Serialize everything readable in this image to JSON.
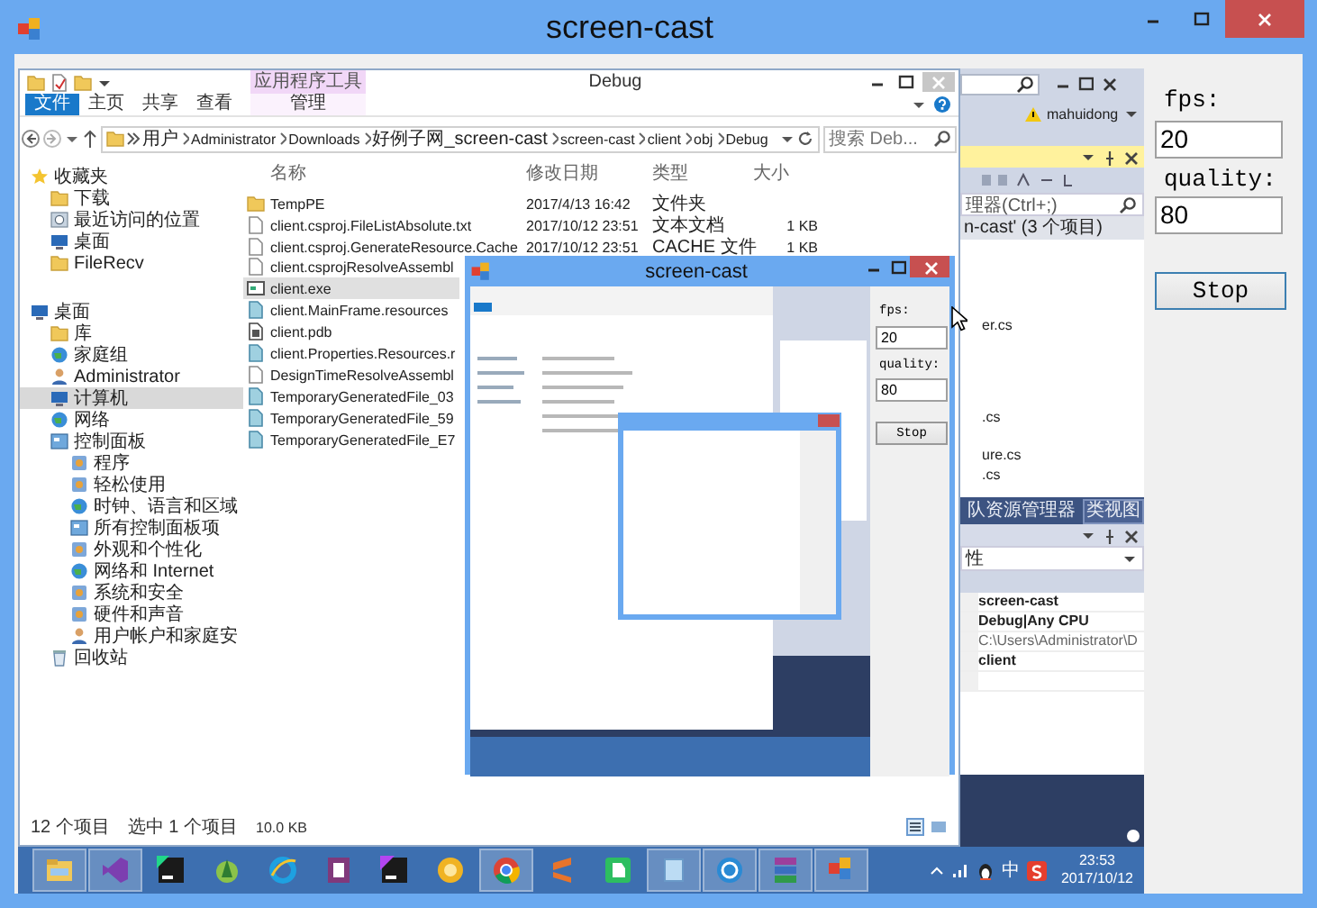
{
  "window": {
    "title": "screen-cast"
  },
  "capture": {
    "explorer": {
      "title": "Debug",
      "context_header": "应用程序工具",
      "ribbon_tabs": [
        {
          "label": "文件",
          "kind": "file",
          "selected": false
        },
        {
          "label": "主页",
          "kind": "tab",
          "selected": false
        },
        {
          "label": "共享",
          "kind": "tab",
          "selected": false
        },
        {
          "label": "查看",
          "kind": "tab",
          "selected": false
        },
        {
          "label": "管理",
          "kind": "context",
          "selected": false
        }
      ],
      "path": [
        "用户",
        "Administrator",
        "Downloads",
        "好例子网_screen-cast",
        "screen-cast",
        "client",
        "obj",
        "Debug"
      ],
      "search": {
        "placeholder": "搜索 Deb..."
      },
      "nav": [
        {
          "label": "收藏夹",
          "kind": "star",
          "selected": false,
          "children": [
            {
              "label": "下载",
              "kind": "folder",
              "selected": false
            },
            {
              "label": "最近访问的位置",
              "kind": "recent",
              "selected": false
            },
            {
              "label": "桌面",
              "kind": "screen",
              "selected": false
            },
            {
              "label": "FileRecv",
              "kind": "folder",
              "selected": false
            }
          ]
        },
        {
          "label": "桌面",
          "kind": "screen",
          "selected": false,
          "children": [
            {
              "label": "库",
              "kind": "library",
              "selected": false
            },
            {
              "label": "家庭组",
              "kind": "homegroup",
              "selected": false
            },
            {
              "label": "Administrator",
              "kind": "user",
              "selected": false
            },
            {
              "label": "计算机",
              "kind": "computer",
              "selected": true
            },
            {
              "label": "网络",
              "kind": "network",
              "selected": false
            },
            {
              "label": "控制面板",
              "kind": "panel",
              "selected": false,
              "children": [
                {
                  "label": "程序",
                  "kind": "setting",
                  "selected": false
                },
                {
                  "label": "轻松使用",
                  "kind": "setting",
                  "selected": false
                },
                {
                  "label": "时钟、语言和区域",
                  "kind": "homegroup",
                  "selected": false
                },
                {
                  "label": "所有控制面板项",
                  "kind": "panel",
                  "selected": false
                },
                {
                  "label": "外观和个性化",
                  "kind": "setting",
                  "selected": false
                },
                {
                  "label": "网络和 Internet",
                  "kind": "network",
                  "selected": false
                },
                {
                  "label": "系统和安全",
                  "kind": "setting",
                  "selected": false
                },
                {
                  "label": "硬件和声音",
                  "kind": "setting",
                  "selected": false
                },
                {
                  "label": "用户帐户和家庭安",
                  "kind": "user",
                  "selected": false
                }
              ]
            },
            {
              "label": "回收站",
              "kind": "trash",
              "selected": false
            }
          ]
        }
      ],
      "columns": [
        "名称",
        "修改日期",
        "类型",
        "大小"
      ],
      "files": [
        {
          "name": "TempPE",
          "date": "2017/4/13 16:42",
          "type": "文件夹",
          "kind": "folder",
          "selected": false
        },
        {
          "name": "client.csproj.FileListAbsolute.txt",
          "date": "2017/10/12 23:51",
          "type": "文本文档",
          "size": "1 KB",
          "kind": "text",
          "selected": false
        },
        {
          "name": "client.csproj.GenerateResource.Cache",
          "date": "2017/10/12 23:51",
          "type": "CACHE 文件",
          "size": "1 KB",
          "kind": "text",
          "selected": false
        },
        {
          "name": "client.csprojResolveAssembl",
          "kind": "text",
          "selected": false
        },
        {
          "name": "client.exe",
          "kind": "exe",
          "selected": true
        },
        {
          "name": "client.MainFrame.resources",
          "kind": "resource",
          "selected": false
        },
        {
          "name": "client.pdb",
          "kind": "pdb",
          "selected": false
        },
        {
          "name": "client.Properties.Resources.r",
          "kind": "resource",
          "selected": false
        },
        {
          "name": "DesignTimeResolveAssembl",
          "kind": "text",
          "selected": false
        },
        {
          "name": "TemporaryGeneratedFile_03",
          "kind": "resource",
          "selected": false
        },
        {
          "name": "TemporaryGeneratedFile_59",
          "kind": "resource",
          "selected": false
        },
        {
          "name": "TemporaryGeneratedFile_E7",
          "kind": "resource",
          "selected": false
        }
      ],
      "status": {
        "count": "12 个项目",
        "selection": "选中 1 个项目",
        "size": "10.0 KB"
      }
    },
    "ide": {
      "user": "mahuidong",
      "search": {
        "placeholder": "理器(Ctrl+;)"
      },
      "solution_header": "n-cast' (3 个项目)",
      "solution_items": [
        "er.cs",
        ".cs",
        "ure.cs",
        ".cs"
      ],
      "tabs": [
        {
          "label": "队资源管理器",
          "selected": false
        },
        {
          "label": "类视图",
          "selected": true
        }
      ],
      "properties_object": "性",
      "properties": [
        {
          "value": "screen-cast",
          "kind": "set"
        },
        {
          "value": "Debug|Any CPU",
          "kind": "set"
        },
        {
          "value": "C:\\Users\\Administrator\\D",
          "kind": "default"
        },
        {
          "value": "client",
          "kind": "set"
        }
      ]
    },
    "inner": {
      "title": "screen-cast",
      "fps_label": "fps:",
      "fps": "20",
      "quality_label": "quality:",
      "quality": "80",
      "stop": "Stop"
    },
    "taskbar": {
      "apps": [
        {
          "kind": "explorer",
          "running": true
        },
        {
          "kind": "vs",
          "running": true
        },
        {
          "kind": "webstorm",
          "running": false
        },
        {
          "kind": "android",
          "running": false
        },
        {
          "kind": "ie",
          "running": false
        },
        {
          "kind": "onenote",
          "running": false
        },
        {
          "kind": "phpstorm",
          "running": false
        },
        {
          "kind": "yellow",
          "running": false
        },
        {
          "kind": "chrome",
          "running": true
        },
        {
          "kind": "sublime",
          "running": false
        },
        {
          "kind": "evernote",
          "running": false
        },
        {
          "kind": "notepad",
          "running": true
        },
        {
          "kind": "example",
          "running": true
        },
        {
          "kind": "winrar",
          "running": true
        },
        {
          "kind": "screencast",
          "running": true
        }
      ],
      "ime": "中",
      "time": "23:53",
      "date": "2017/10/12"
    }
  },
  "controls": {
    "fps_label": "fps:",
    "fps": "20",
    "quality_label": "quality:",
    "quality": "80",
    "stop": "Stop"
  }
}
